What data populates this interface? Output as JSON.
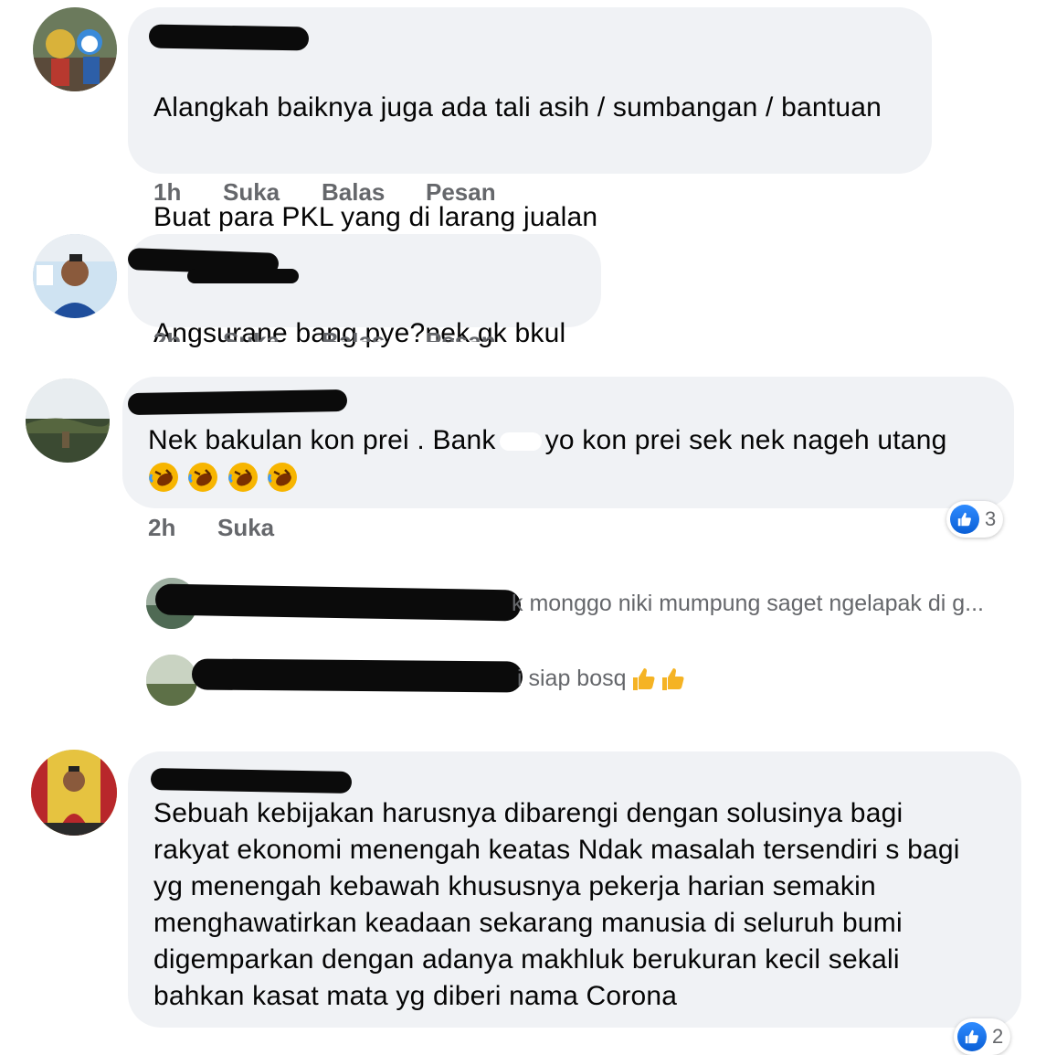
{
  "comments": [
    {
      "text_lines": [
        "Alangkah baiknya juga ada tali asih / sumbangan / bantuan",
        "",
        "Buat para PKL yang di larang jualan"
      ],
      "time": "1h",
      "actions": [
        "Suka",
        "Balas",
        "Pesan"
      ]
    },
    {
      "text_lines": [
        "Angsurane bang pye?nek gk bkul"
      ],
      "time": "2h",
      "actions": [
        "Suka",
        "Balas",
        "Pesan"
      ]
    },
    {
      "text_lines": [
        "Nek bakulan kon prei .  Bank",
        "yo kon prei sek nek nageh utang"
      ],
      "time": "2h",
      "actions": [
        "Suka"
      ],
      "emoji_name": "rolling-on-floor-laughing",
      "emoji_count": 4,
      "like_count": "3",
      "replies": [
        {
          "text": "k monggo niki mumpung saget ngelapak di g..."
        },
        {
          "text": "i siap bosq"
        }
      ]
    },
    {
      "text_lines": [
        "Sebuah kebijakan harusnya dibarengi dengan solusinya bagi",
        "rakyat ekonomi menengah keatas Ndak masalah tersendiri s bagi",
        "yg menengah kebawah khususnya pekerja harian semakin",
        "menghawatirkan keadaan sekarang  manusia di seluruh bumi",
        "digemparkan dengan adanya makhluk berukuran kecil sekali",
        "bahkan kasat mata yg diberi nama Corona"
      ],
      "like_count": "2"
    }
  ],
  "colors": {
    "bubble": "#f0f2f5",
    "meta_text": "#65676b",
    "like_blue": "#1877f2",
    "redaction": "#0b0b0b"
  }
}
